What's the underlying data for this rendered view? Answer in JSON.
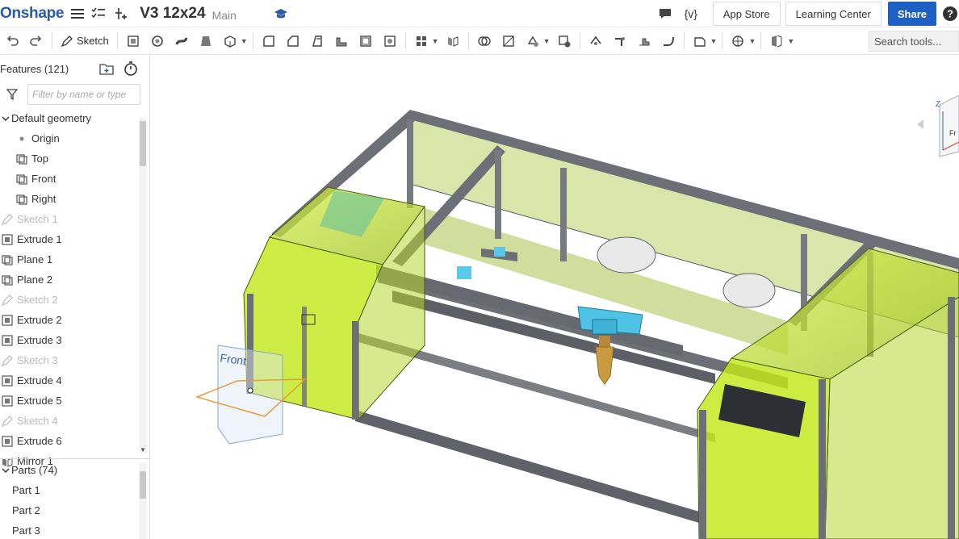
{
  "app": {
    "logo": "Onshape"
  },
  "document": {
    "title": "V3 12x24",
    "branch": "Main"
  },
  "topbar": {
    "app_store_label": "App Store",
    "learning_center_label": "Learning Center",
    "share_label": "Share",
    "variables_label": "{v}"
  },
  "toolbar": {
    "sketch_label": "Sketch",
    "search_placeholder": "Search tools..."
  },
  "features": {
    "header": "Features (121)",
    "filter_placeholder": "Filter by name or type",
    "default_geometry_label": "Default geometry",
    "items": [
      {
        "label": "Origin",
        "icon": "origin-dot-icon",
        "dim": false
      },
      {
        "label": "Top",
        "icon": "plane-icon",
        "dim": false
      },
      {
        "label": "Front",
        "icon": "plane-icon",
        "dim": false
      },
      {
        "label": "Right",
        "icon": "plane-icon",
        "dim": false
      },
      {
        "label": "Sketch 1",
        "icon": "sketch-icon",
        "dim": true
      },
      {
        "label": "Extrude 1",
        "icon": "extrude-icon",
        "dim": false
      },
      {
        "label": "Plane 1",
        "icon": "plane-icon",
        "dim": false
      },
      {
        "label": "Plane 2",
        "icon": "plane-icon",
        "dim": false
      },
      {
        "label": "Sketch 2",
        "icon": "sketch-icon",
        "dim": true
      },
      {
        "label": "Extrude 2",
        "icon": "extrude-icon",
        "dim": false
      },
      {
        "label": "Extrude 3",
        "icon": "extrude-icon",
        "dim": false
      },
      {
        "label": "Sketch 3",
        "icon": "sketch-icon",
        "dim": true
      },
      {
        "label": "Extrude 4",
        "icon": "extrude-icon",
        "dim": false
      },
      {
        "label": "Extrude 5",
        "icon": "extrude-icon",
        "dim": false
      },
      {
        "label": "Sketch 4",
        "icon": "sketch-icon",
        "dim": true
      },
      {
        "label": "Extrude 6",
        "icon": "extrude-icon",
        "dim": false
      },
      {
        "label": "Mirror 1",
        "icon": "mirror-icon",
        "dim": false
      }
    ]
  },
  "parts": {
    "header": "Parts (74)",
    "items": [
      "Part 1",
      "Part 2",
      "Part 3"
    ]
  },
  "viewport": {
    "front_plane_label": "Front",
    "viewcube_axis_z": "Z",
    "viewcube_face": "Fr"
  },
  "colors": {
    "brand": "#2a5aa8",
    "share_button": "#1e5fc4",
    "frame_yellow_green": "#c3e617",
    "panel_green": "#a7c93c",
    "highlight_cyan": "#4fc3e6",
    "extrusion_gray": "#7b7f85"
  }
}
